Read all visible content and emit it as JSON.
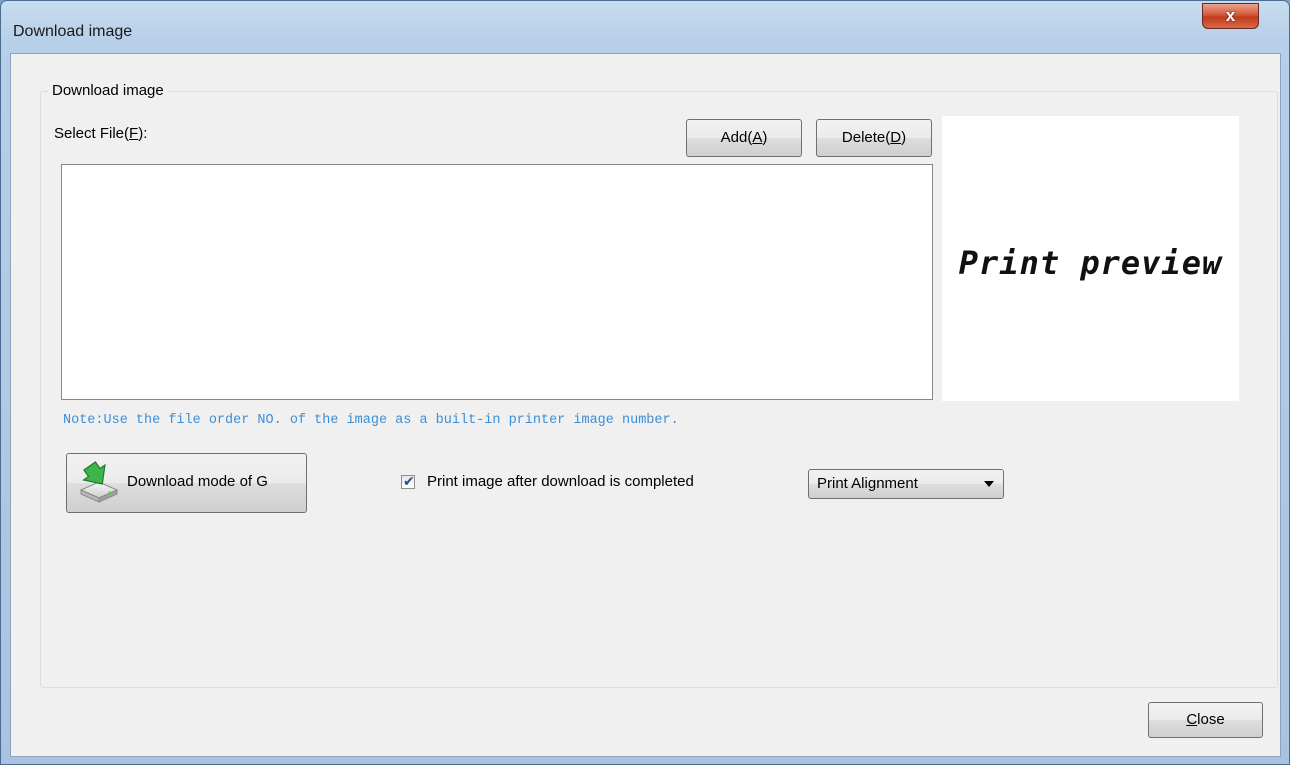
{
  "window": {
    "title": "Download image",
    "close_glyph": "x"
  },
  "group": {
    "legend": "Download image"
  },
  "file_select": {
    "label_prefix": "Select File(",
    "label_key": "F",
    "label_suffix": "):",
    "add_prefix": "Add(",
    "add_key": "A",
    "add_suffix": ")",
    "delete_prefix": "Delete(",
    "delete_key": "D",
    "delete_suffix": ")"
  },
  "preview": {
    "text": "Print preview"
  },
  "note": "Note:Use the file order NO. of the image as a built-in printer image number.",
  "download_button": {
    "label": "Download mode of G",
    "icon": "download-disk-icon"
  },
  "print_after_download": {
    "label": "Print image after download is completed",
    "checked": true,
    "check_glyph": "✔"
  },
  "alignment_select": {
    "value": "Print Alignment",
    "icon": "chevron-down-icon"
  },
  "footer": {
    "close_key": "C",
    "close_rest": "lose"
  },
  "colors": {
    "note": "#3c8fd6",
    "close_button": "#c23b1d",
    "title_bar": "#b7cfe8"
  }
}
